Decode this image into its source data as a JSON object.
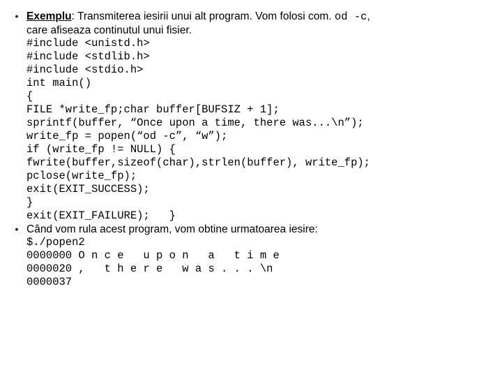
{
  "bullet1": {
    "intro_prefix_bold_underline": "Exemplu",
    "intro_after_colon": ": Transmiterea iesirii unui alt program. Vom folosi com. ",
    "intro_mono": "od -c",
    "intro_comma": ",",
    "intro_line2": "care afiseaza continutul unui fisier.",
    "code_lines": [
      "#include <unistd.h>",
      "#include <stdlib.h>",
      "#include <stdio.h>",
      "int main()",
      "{",
      "FILE *write_fp;char buffer[BUFSIZ + 1];",
      "sprintf(buffer, “Once upon a time, there was...\\n”);",
      "write_fp = popen(“od -c”, “w”);",
      "if (write_fp != NULL) {",
      "fwrite(buffer,sizeof(char),strlen(buffer), write_fp);",
      "pclose(write_fp);",
      "exit(EXIT_SUCCESS);",
      "}",
      "exit(EXIT_FAILURE);   }"
    ]
  },
  "bullet2": {
    "intro": "Când vom rula acest program, vom obtine urmatoarea iesire:",
    "out_lines": [
      "$./popen2",
      "0000000 O n c e   u p o n   a   t i m e",
      "0000020 ,   t h e r e   w a s . . . \\n",
      "0000037"
    ]
  }
}
